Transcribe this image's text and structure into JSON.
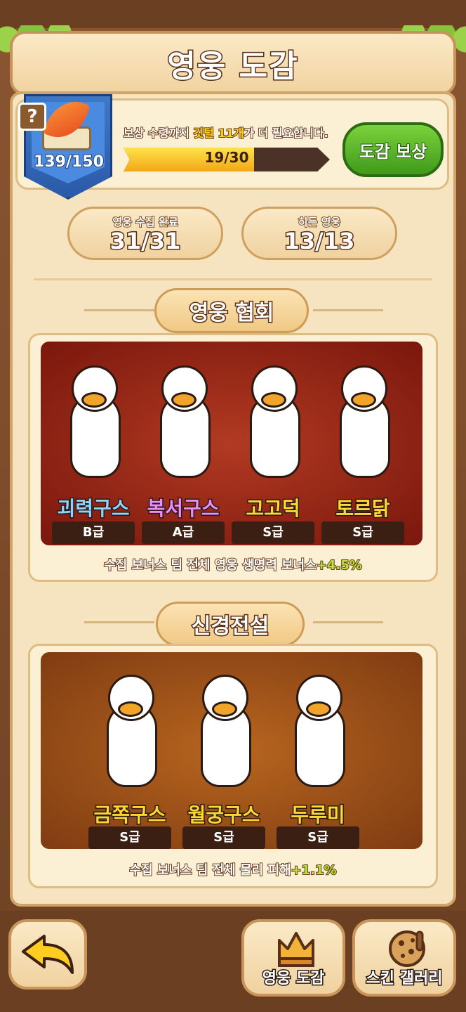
{
  "title": "영웅 도감",
  "badge": {
    "count": "139/150"
  },
  "notice": {
    "pre": "보상 수령까지 ",
    "highlight": "깃털 11개",
    "post": "가 더 필요합니다."
  },
  "progress": {
    "text": "19/30",
    "fraction": 0.633
  },
  "reward_button": "도감 보상",
  "stats": [
    {
      "label": "영웅 수집 완료",
      "value": "31/31"
    },
    {
      "label": "히든 영웅",
      "value": "13/13"
    }
  ],
  "sections": [
    {
      "title": "영웅 협회",
      "heroes": [
        {
          "name": "괴력구스",
          "grade": "B급",
          "color": "#8fd2ff"
        },
        {
          "name": "복서구스",
          "grade": "A급",
          "color": "#e98cff"
        },
        {
          "name": "고고덕",
          "grade": "S급",
          "color": "#ffd733"
        },
        {
          "name": "토르닭",
          "grade": "S급",
          "color": "#ffd733"
        }
      ],
      "bonus_prefix": "수집 보너스 팀 전체 영웅 생명력 보너스",
      "bonus_value": "+4.5%"
    },
    {
      "title": "신경전설",
      "heroes": [
        {
          "name": "금쪽구스",
          "grade": "S급",
          "color": "#ffd733"
        },
        {
          "name": "월궁구스",
          "grade": "S급",
          "color": "#ffd733"
        },
        {
          "name": "두루미",
          "grade": "S급",
          "color": "#ffd733"
        }
      ],
      "bonus_prefix": "수집 보너스 팀 전체 물리 피해",
      "bonus_value": "+1.1%"
    }
  ],
  "nav": {
    "collection": "영웅 도감",
    "skins": "스킨 갤러리"
  },
  "colors": {
    "section1_bg": "#8a1d12",
    "section2_bg": "#8a4515",
    "accent_green": "#4fae22",
    "gold": "#ffd21a"
  },
  "icons": [
    "question-icon",
    "feather-icon",
    "book-icon",
    "back-arrow-icon",
    "crown-icon",
    "cookie-icon"
  ]
}
